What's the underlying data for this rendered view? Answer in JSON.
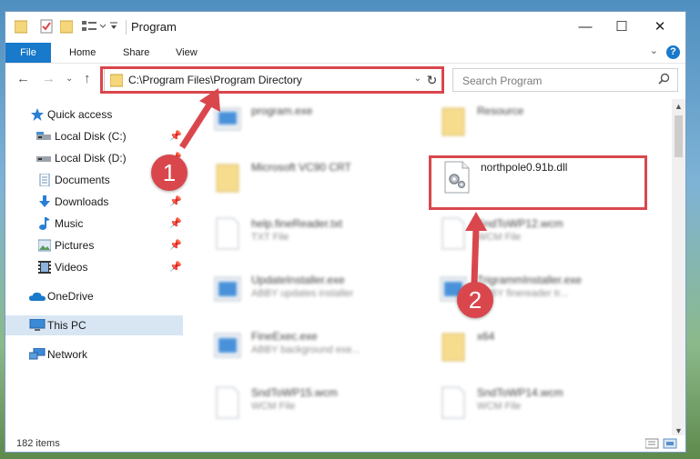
{
  "window": {
    "title": "Program"
  },
  "ribbon": {
    "tabs": [
      "File",
      "Home",
      "Share",
      "View"
    ],
    "help": "?"
  },
  "address": {
    "path": "C:\\Program Files\\Program Directory"
  },
  "search": {
    "placeholder": "Search Program"
  },
  "sidebar": {
    "items": [
      {
        "label": "Quick access",
        "icon": "star-icon",
        "pinned": false
      },
      {
        "label": "Local Disk (C:)",
        "icon": "drive-icon",
        "pinned": true
      },
      {
        "label": "Local Disk (D:)",
        "icon": "drive-icon",
        "pinned": true
      },
      {
        "label": "Documents",
        "icon": "documents-icon",
        "pinned": true
      },
      {
        "label": "Downloads",
        "icon": "download-icon",
        "pinned": true
      },
      {
        "label": "Music",
        "icon": "music-icon",
        "pinned": true
      },
      {
        "label": "Pictures",
        "icon": "pictures-icon",
        "pinned": true
      },
      {
        "label": "Videos",
        "icon": "videos-icon",
        "pinned": true
      },
      {
        "label": "OneDrive",
        "icon": "onedrive-icon",
        "pinned": false
      },
      {
        "label": "This PC",
        "icon": "computer-icon",
        "pinned": false,
        "selected": true
      },
      {
        "label": "Network",
        "icon": "network-icon",
        "pinned": false
      }
    ]
  },
  "files": [
    {
      "name": "program.exe",
      "type": "",
      "icon": "exe-icon"
    },
    {
      "name": "Resource",
      "type": "",
      "icon": "folder-icon"
    },
    {
      "name": "Microsoft VC90 CRT",
      "type": "",
      "icon": "folder-icon"
    },
    {
      "name": "northpole0.91b.dll",
      "type": "",
      "icon": "dll-icon",
      "highlighted": true
    },
    {
      "name": "help.fineReader.txt",
      "type": "TXT File",
      "icon": "text-file-icon"
    },
    {
      "name": "SndToWP12.wcm",
      "type": "WCM File",
      "icon": "text-file-icon"
    },
    {
      "name": "UpdateInstaller.exe",
      "type": "ABBY updates installer",
      "icon": "exe-icon"
    },
    {
      "name": "TrigrammInstaller.exe",
      "type": "ABBY finereader tr...",
      "icon": "exe-icon"
    },
    {
      "name": "FineExec.exe",
      "type": "ABBY background exe...",
      "icon": "exe-icon"
    },
    {
      "name": "x64",
      "type": "",
      "icon": "folder-icon"
    },
    {
      "name": "SndToWP15.wcm",
      "type": "WCM File",
      "icon": "text-file-icon"
    },
    {
      "name": "SndToWP14.wcm",
      "type": "WCM File",
      "icon": "text-file-icon"
    }
  ],
  "status": {
    "count": "182 items"
  },
  "annotations": {
    "step1": "1",
    "step2": "2"
  },
  "colors": {
    "accent": "#1979ca",
    "highlight": "#d9474d",
    "selection": "#d8e6f4"
  }
}
